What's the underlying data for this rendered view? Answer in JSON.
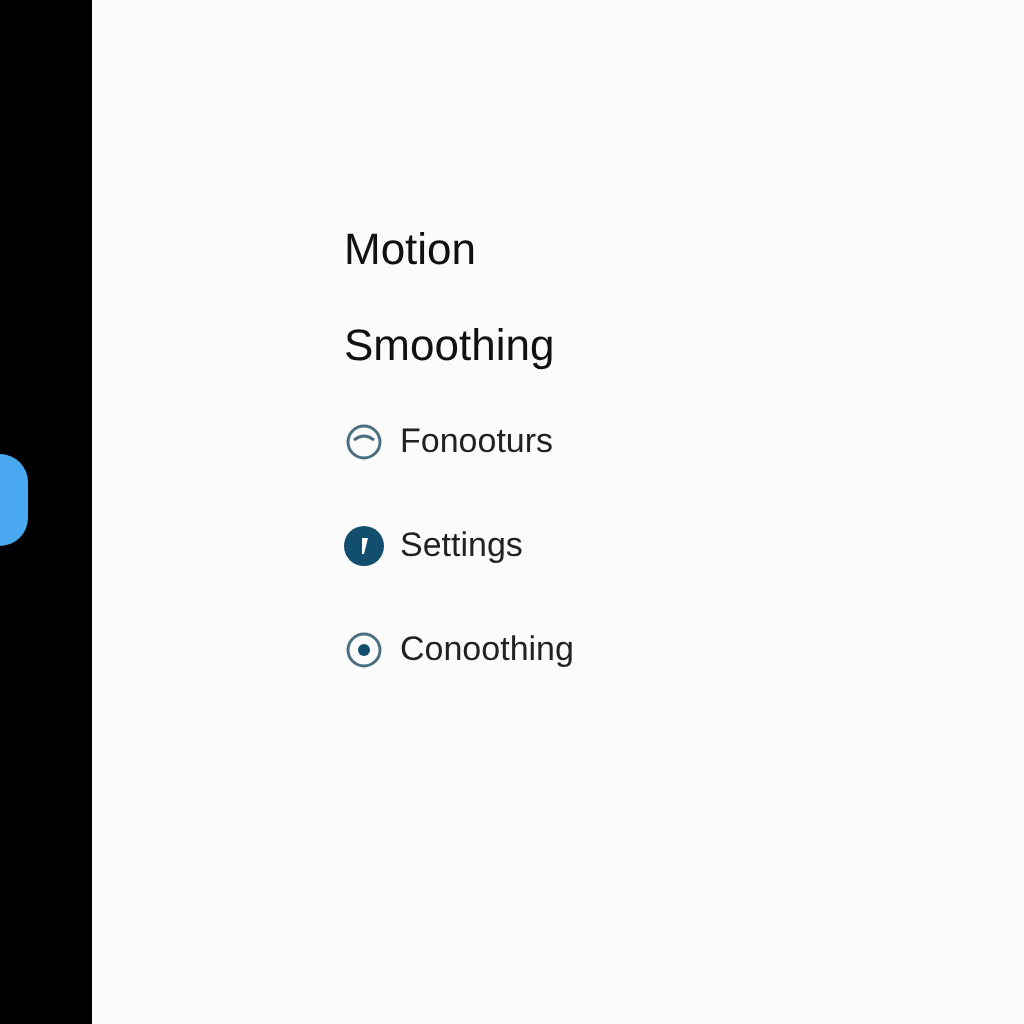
{
  "title_lines": [
    "Motion",
    "Smoothing"
  ],
  "options": [
    {
      "label": "Fonooturs",
      "kind": "arc"
    },
    {
      "label": "Settings",
      "kind": "filled"
    },
    {
      "label": "Conoothing",
      "kind": "radio"
    }
  ]
}
